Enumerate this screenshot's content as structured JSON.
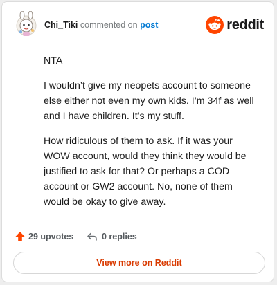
{
  "header": {
    "author": "Chi_Tiki",
    "action_text": "commented on",
    "post_link": "post",
    "brand_name": "reddit"
  },
  "comment": {
    "paragraphs": [
      "NTA",
      "I wouldn’t give my neopets account to someone else either not even my own kids. I’m 34f as well and I have children. It’s my stuff.",
      "How ridiculous of them to ask. If it was your WOW account, would they think they would be justified to ask for that? Or perhaps a COD account or GW2 account. No, none of them would be okay to give away."
    ]
  },
  "footer": {
    "upvotes_label": "29 upvotes",
    "replies_label": "0 replies",
    "view_more_label": "View more on Reddit"
  },
  "colors": {
    "brand": "#ff4500",
    "link": "#0079d3",
    "view_more": "#d93a00"
  },
  "icons": {
    "avatar": "avatar",
    "brand": "reddit-logo-icon",
    "upvote": "upvote-arrow-icon",
    "reply": "reply-arrow-icon"
  }
}
